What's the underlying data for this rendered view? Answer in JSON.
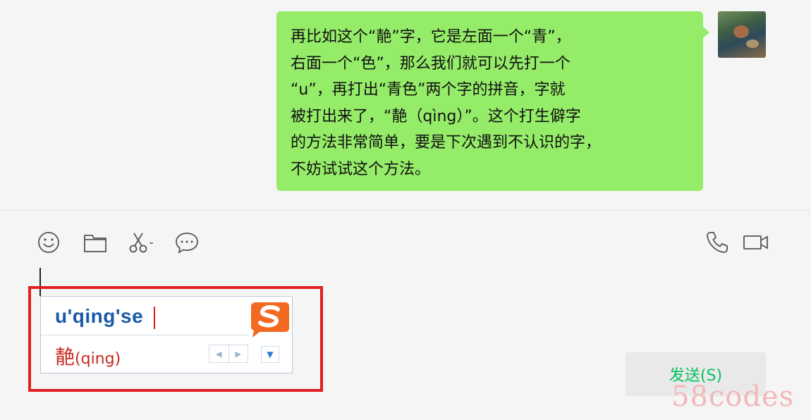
{
  "chat": {
    "messages": [
      {
        "sender": "self",
        "lines": [
          "再比如这个“靘”字，它是左面一个“青”，",
          "右面一个“色”，那么我们就可以先打一个",
          "“u”，再打出“青色”两个字的拼音，字就",
          "被打出来了，“靘（qìng）”。这个打生僻字",
          "的方法非常简单，要是下次遇到不认识的字，",
          "不妨试试这个方法。"
        ],
        "bubble_color": "#95ec69"
      }
    ]
  },
  "toolbar": {
    "icons": [
      "emoji-icon",
      "folder-icon",
      "scissors-icon",
      "chat-bubble-icon",
      "phone-icon",
      "video-icon"
    ]
  },
  "ime": {
    "composition": "u'qing'se",
    "candidate_char": "靘",
    "candidate_pinyin": "(qing)",
    "prev_page": "◀",
    "next_page": "▶",
    "menu": "▼",
    "logo": "S"
  },
  "send_button": {
    "label": "发送(S)"
  },
  "watermark": "58codes",
  "colors": {
    "accent_green": "#07c160",
    "bubble_green": "#95ec69",
    "highlight_red": "#e02020",
    "ime_blue": "#1a5aa8",
    "candidate_red": "#c8281e"
  }
}
